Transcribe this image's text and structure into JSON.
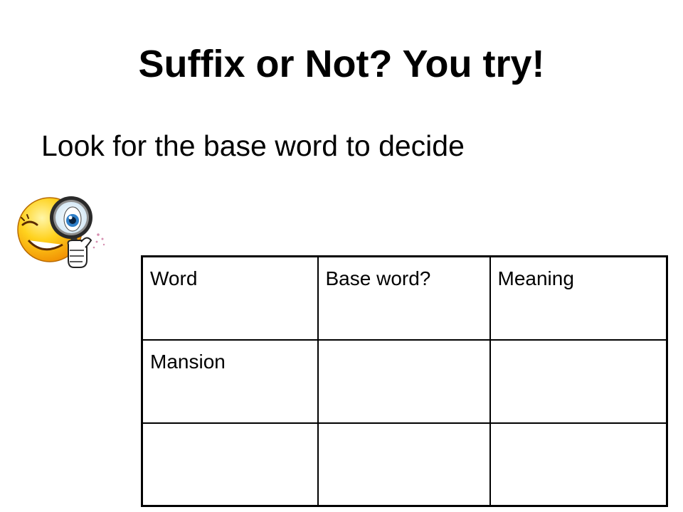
{
  "slide": {
    "title": "Suffix or Not? You try!",
    "subtitle": "Look for the base word to decide"
  },
  "clipart": {
    "icon": "smiley-magnifying-glass-icon",
    "face_color": "#f7b500",
    "eye_color": "#2f7fc8"
  },
  "table": {
    "headers": [
      "Word",
      "Base word?",
      "Meaning"
    ],
    "rows": [
      [
        "Mansion",
        "",
        ""
      ],
      [
        "",
        "",
        ""
      ]
    ]
  }
}
